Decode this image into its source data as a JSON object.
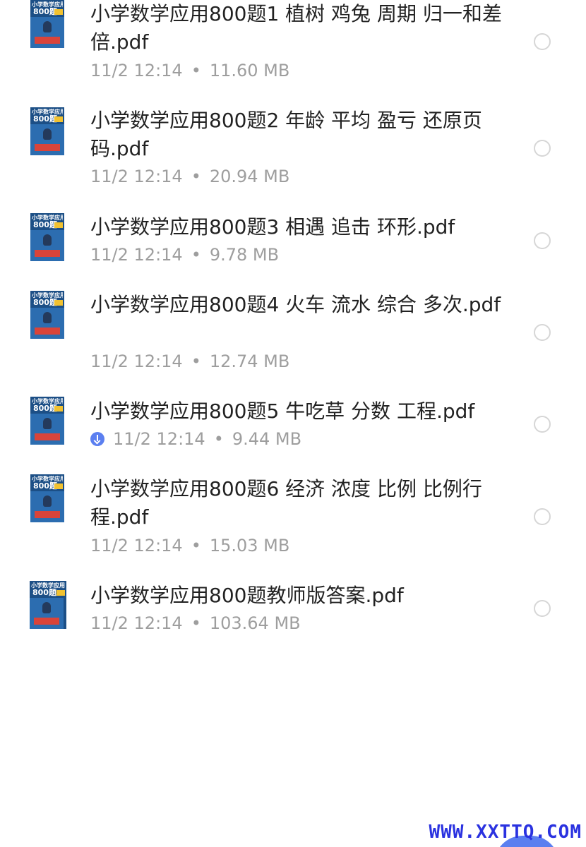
{
  "files": [
    {
      "title": "小学数学应用800题1 植树 鸡兔 周期 归一和差倍.pdf",
      "date": "11/2 12:14",
      "size": "11.60 MB",
      "downloaded": false,
      "thumb": {
        "title": "小学数学应用",
        "num": "800题"
      }
    },
    {
      "title": "小学数学应用800题2 年龄 平均 盈亏 还原页码.pdf",
      "date": "11/2 12:14",
      "size": "20.94 MB",
      "downloaded": false,
      "thumb": {
        "title": "小学数学应用",
        "num": "800题"
      }
    },
    {
      "title": "小学数学应用800题3 相遇 追击 环形.pdf",
      "date": "11/2 12:14",
      "size": "9.78 MB",
      "downloaded": false,
      "thumb": {
        "title": "小学数学应用",
        "num": "800题"
      }
    },
    {
      "title": "小学数学应用800题4 火车 流水 综合 多次.pdf",
      "date": "11/2 12:14",
      "size": "12.74 MB",
      "downloaded": false,
      "thumb": {
        "title": "小学数学应用",
        "num": "800题"
      }
    },
    {
      "title": "小学数学应用800题5 牛吃草 分数 工程.pdf",
      "date": "11/2 12:14",
      "size": "9.44 MB",
      "downloaded": true,
      "thumb": {
        "title": "小学数学应用",
        "num": "800题"
      }
    },
    {
      "title": "小学数学应用800题6 经济 浓度 比例 比例行程.pdf",
      "date": "11/2 12:14",
      "size": "15.03 MB",
      "downloaded": false,
      "thumb": {
        "title": "小学数学应用",
        "num": "800题"
      }
    },
    {
      "title": "小学数学应用800题教师版答案.pdf",
      "date": "11/2 12:14",
      "size": "103.64 MB",
      "downloaded": false,
      "thumb": {
        "title": "小学数学应用",
        "num": "800题"
      }
    }
  ],
  "meta_separator": "•",
  "watermark": "WWW.XXTTQ.COM",
  "colors": {
    "title_text": "#222222",
    "meta_text": "#9e9e9e",
    "radio_border": "#d6d6d6",
    "download_accent": "#5b7ff0",
    "watermark": "#2a32e0",
    "thumb_cover": "#1c4f86"
  },
  "icons": {
    "download_status": "download-circle-icon",
    "select": "radio-unchecked-icon"
  }
}
